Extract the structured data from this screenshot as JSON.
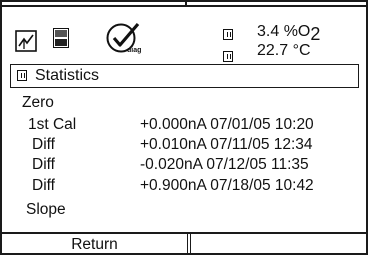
{
  "header": {
    "icons": [
      "trend-icon",
      "memory-card-icon",
      "diag-check-icon"
    ],
    "diag_label": "diag",
    "measurement_1": {
      "value": "3.4 %O",
      "unit_sub": "2"
    },
    "measurement_2": {
      "value": "22.7 °C"
    }
  },
  "menu": {
    "title": "Statistics"
  },
  "statistics": {
    "zero_label": "Zero",
    "rows": [
      {
        "label": "1st Cal",
        "value": "+0.000nA 07/01/05 10:20"
      },
      {
        "label": "Diff",
        "value": "+0.010nA 07/11/05 12:34"
      },
      {
        "label": "Diff",
        "value": "-0.020nA 07/12/05 11:35"
      },
      {
        "label": "Diff",
        "value": "+0.900nA 07/18/05 10:42"
      }
    ],
    "slope_label": "Slope"
  },
  "footer": {
    "left_button": "Return",
    "right_button": ""
  }
}
